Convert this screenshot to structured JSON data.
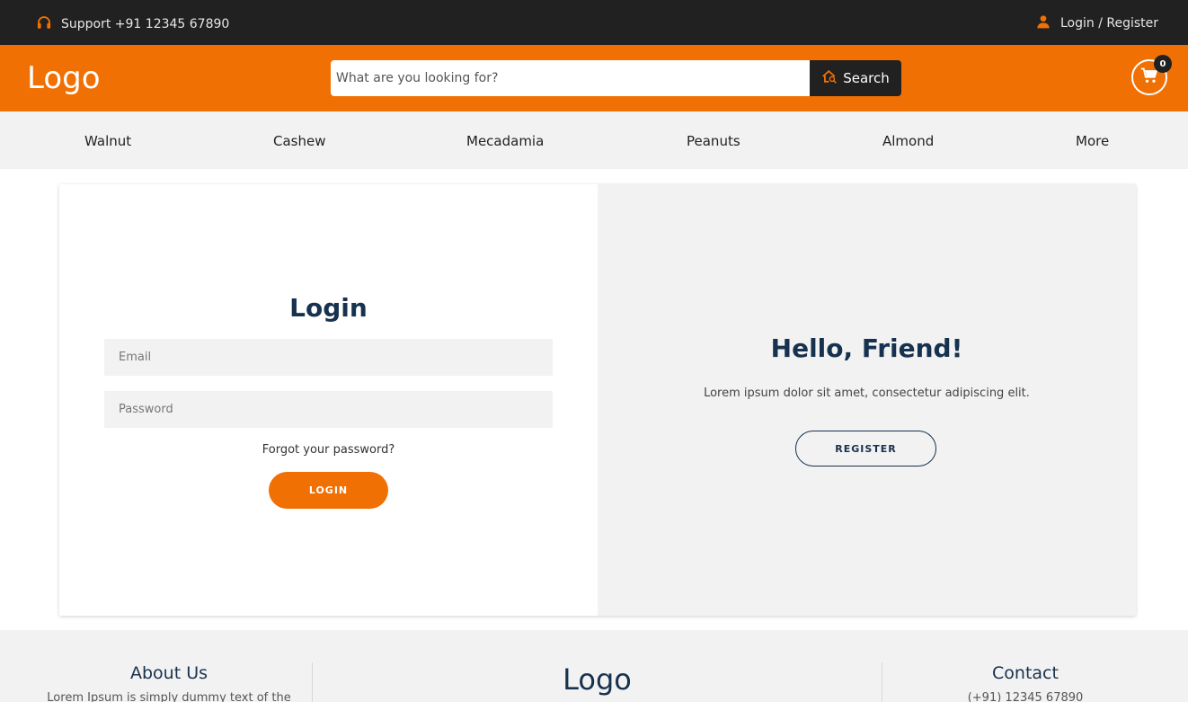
{
  "topbar": {
    "support_text": "Support +91 12345 67890",
    "account_text": "Login / Register"
  },
  "header": {
    "logo": "Logo",
    "search_placeholder": "What are you looking for?",
    "search_button": "Search",
    "cart_count": "0"
  },
  "nav": {
    "items": [
      "Walnut",
      "Cashew",
      "Mecadamia",
      "Peanuts",
      "Almond",
      "More"
    ]
  },
  "login": {
    "title": "Login",
    "email_placeholder": "Email",
    "password_placeholder": "Password",
    "forgot": "Forgot your password?",
    "button": "LOGIN"
  },
  "welcome": {
    "title": "Hello, Friend!",
    "text": "Lorem ipsum dolor sit amet, consectetur adipiscing elit.",
    "button": "REGISTER"
  },
  "footer": {
    "about_title": "About Us",
    "about_text": "Lorem Ipsum is simply dummy text of the",
    "logo": "Logo",
    "contact_title": "Contact",
    "contact_text": "(+91) 12345 67890"
  },
  "colors": {
    "accent": "#f07004",
    "dark": "#212121",
    "heading": "#17324f",
    "panel": "#f2f2f2"
  }
}
